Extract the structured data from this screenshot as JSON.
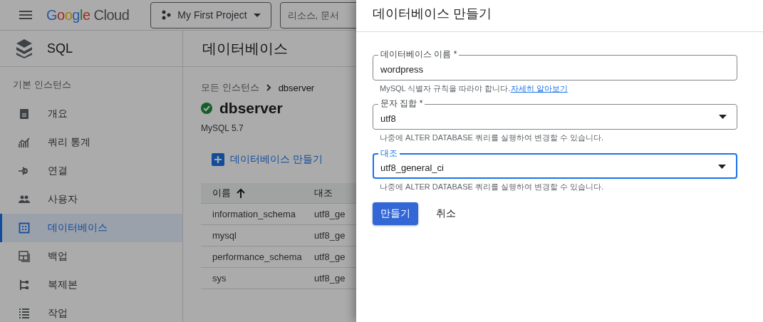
{
  "top_bar": {
    "logo": "Google Cloud",
    "project": "My First Project",
    "search": {
      "placeholder": "리소스, 문서"
    }
  },
  "sidebar": {
    "product": "SQL",
    "section": "기본 인스턴스",
    "items": [
      {
        "label": "개요",
        "kind": "doc",
        "selected": false
      },
      {
        "label": "쿼리 통계",
        "kind": "chart",
        "selected": false
      },
      {
        "label": "연결",
        "kind": "connect",
        "selected": false
      },
      {
        "label": "사용자",
        "kind": "users",
        "selected": false
      },
      {
        "label": "데이터베이스",
        "kind": "grid",
        "selected": true
      },
      {
        "label": "백업",
        "kind": "backup",
        "selected": false
      },
      {
        "label": "복제본",
        "kind": "tree",
        "selected": false
      },
      {
        "label": "작업",
        "kind": "list",
        "selected": false
      }
    ]
  },
  "page": {
    "title": "데이터베이스",
    "breadcrumb": [
      "모든 인스턴스",
      "dbserver"
    ],
    "instance": "dbserver",
    "version": "MySQL 5.7",
    "create_link": "데이터베이스 만들기",
    "table": {
      "columns": [
        {
          "label": "이름",
          "sorted": true
        },
        {
          "label": "대조",
          "sorted": false
        }
      ],
      "rows": [
        [
          "information_schema",
          "utf8_ge"
        ],
        [
          "mysql",
          "utf8_ge"
        ],
        [
          "performance_schema",
          "utf8_ge"
        ],
        [
          "sys",
          "utf8_ge"
        ]
      ]
    }
  },
  "drawer": {
    "title": "데이터베이스 만들기",
    "fields": [
      {
        "label": "데이터베이스 이름 *",
        "value": "wordpress",
        "kind": "text",
        "focused": false,
        "hint": "MySQL 식별자 규칙을 따라야 합니다.",
        "hint_link": "자세히 알아보기"
      },
      {
        "label": "문자 집합 *",
        "value": "utf8",
        "kind": "select",
        "focused": false,
        "hint": "나중에 ALTER DATABASE 쿼리를 실행하여 변경할 수 있습니다."
      },
      {
        "label": "대조",
        "value": "utf8_general_ci",
        "kind": "select",
        "focused": true,
        "hint": "나중에 ALTER DATABASE 쿼리를 실행하여 변경할 수 있습니다."
      }
    ],
    "buttons": [
      {
        "label": "만들기",
        "kind": "primary"
      },
      {
        "label": "취소",
        "kind": "text"
      }
    ]
  }
}
